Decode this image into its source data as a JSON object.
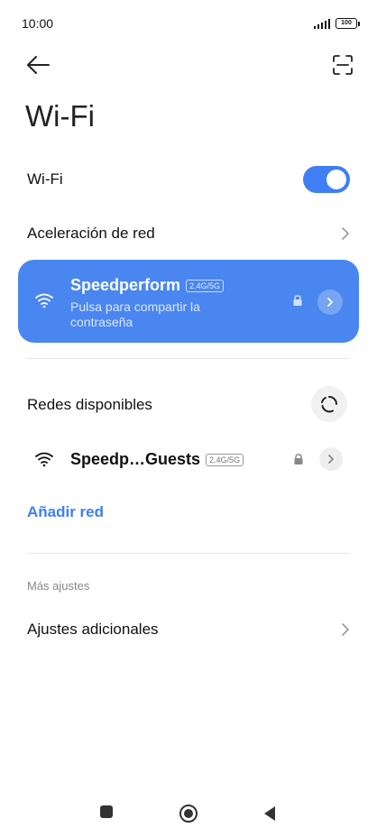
{
  "status": {
    "time": "10:00",
    "battery": "100"
  },
  "header": {
    "title": "Wi-Fi"
  },
  "wifi_toggle": {
    "label": "Wi-Fi",
    "enabled": true
  },
  "network_acceleration": {
    "label": "Aceleración de red"
  },
  "connected_network": {
    "name": "Speedperform",
    "band": "2.4G/5G",
    "subtitle": "Pulsa para compartir la contraseña",
    "secured": true
  },
  "available": {
    "title": "Redes disponibles",
    "networks": [
      {
        "name": "Speedp…Guests",
        "band": "2.4G/5G",
        "secured": true
      }
    ]
  },
  "add_network": {
    "label": "Añadir red"
  },
  "more_settings": {
    "section_label": "Más ajustes",
    "additional": {
      "label": "Ajustes adicionales"
    }
  },
  "colors": {
    "accent": "#3f7ef3",
    "card": "#4a86ef"
  },
  "icons": [
    "back-arrow-icon",
    "scan-icon",
    "wifi-icon",
    "lock-icon",
    "chevron-right-icon",
    "refresh-icon",
    "square-icon",
    "circle-icon",
    "triangle-back-icon"
  ]
}
